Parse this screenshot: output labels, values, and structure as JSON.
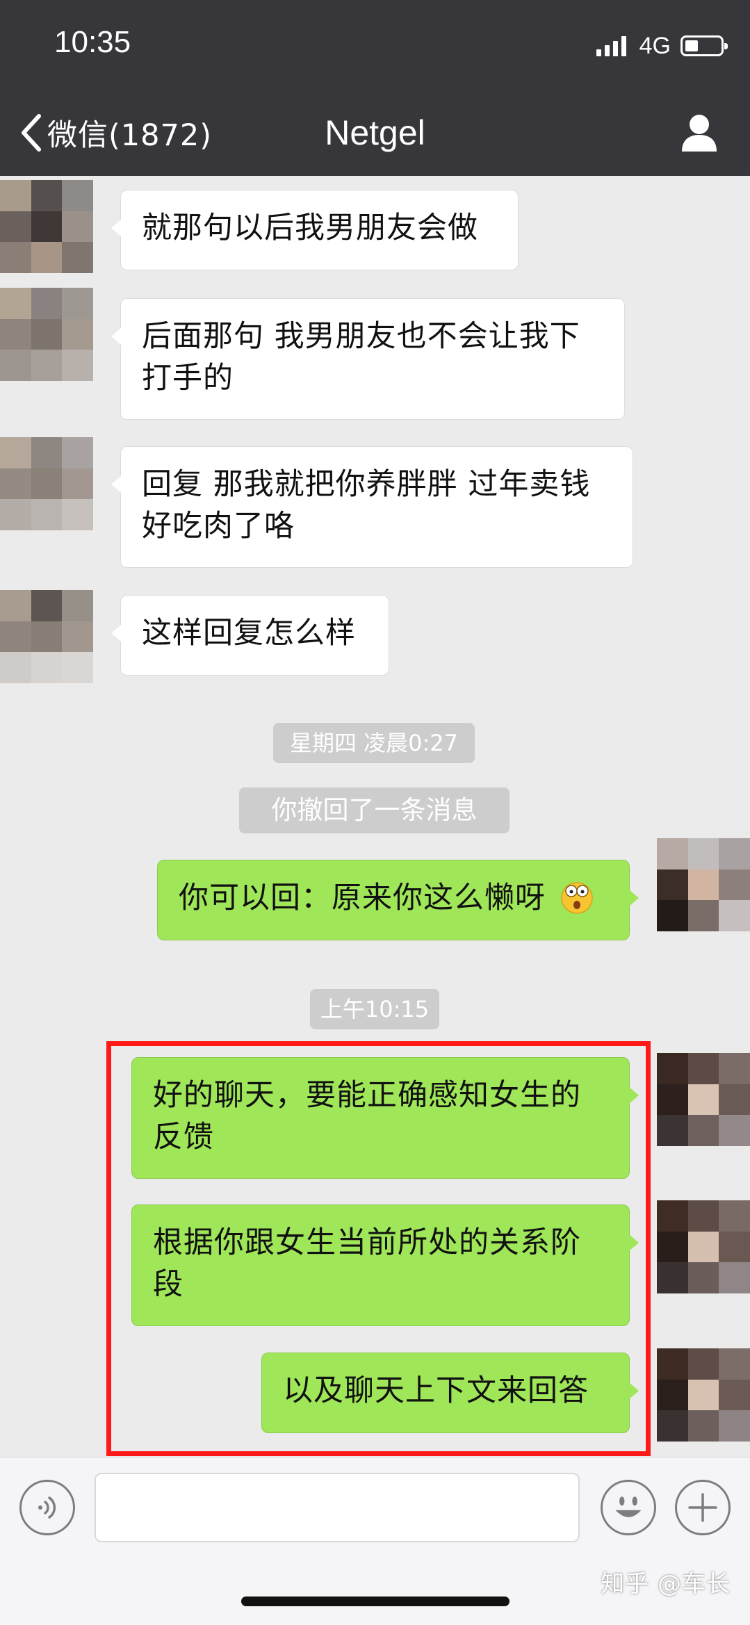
{
  "status_bar": {
    "time": "10:35",
    "network": "4G"
  },
  "nav": {
    "back_label": "微信(1872)",
    "title": "Netgel"
  },
  "messages": {
    "m1": "就那句以后我男朋友会做",
    "m2_line1": "后面那句 我男朋友也不会让我下",
    "m2_line2": "打手的",
    "m3_line1": "回复 那我就把你养胖胖 过年卖钱",
    "m3_line2": "好吃肉了咯",
    "m4": "这样回复怎么样",
    "time1": "星期四 凌晨0:27",
    "recall_notice": "你撤回了一条消息",
    "m5": "你可以回：原来你这么懒呀",
    "time2": "上午10:15",
    "m6_line1": "好的聊天，要能正确感知女生的",
    "m6_line2": "反馈",
    "m7_line1": "根据你跟女生当前所处的关系阶",
    "m7_line2": "段",
    "m8": "以及聊天上下文来回答"
  },
  "input": {
    "placeholder": ""
  },
  "watermark": "知乎 @车长",
  "colors": {
    "header_bg": "#37373b",
    "chat_bg": "#ebebeb",
    "bubble_out": "#9fe658",
    "bubble_in": "#ffffff",
    "highlight_border": "#ff1a1a"
  },
  "icons": {
    "back": "chevron-left-icon",
    "profile": "person-icon",
    "voice": "voice-icon",
    "emoji": "smiley-icon",
    "add": "plus-icon",
    "message_emoji": "shocked-face-emoji"
  }
}
